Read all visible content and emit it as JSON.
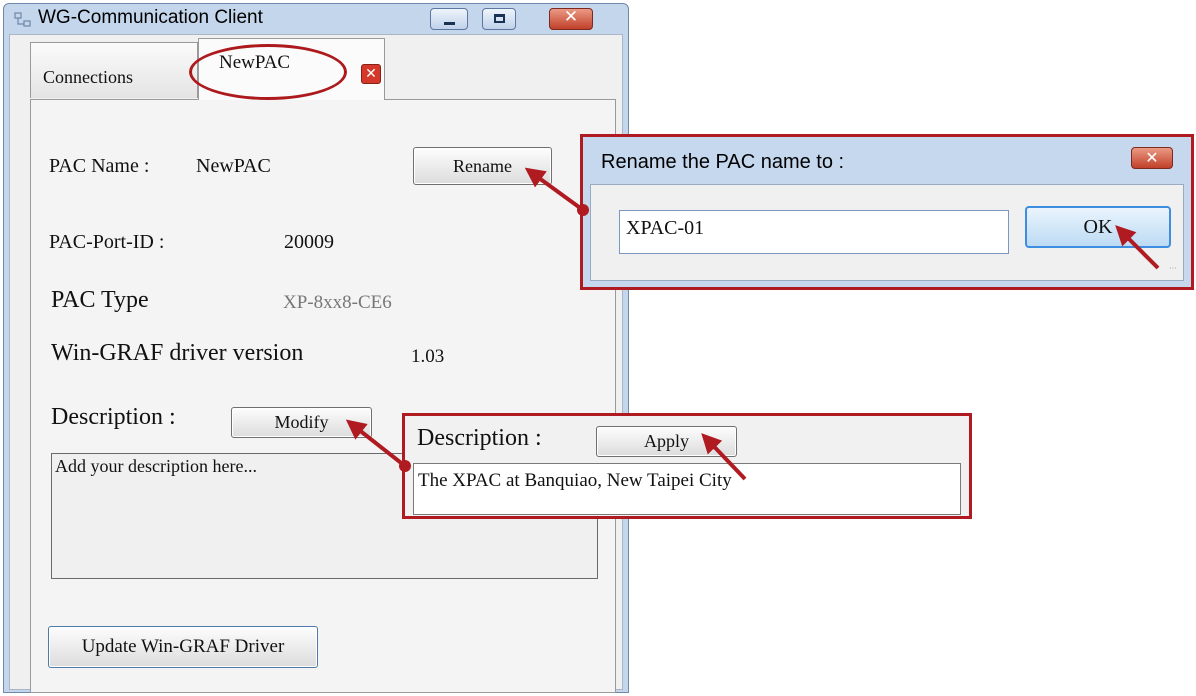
{
  "window": {
    "title": "WG-Communication Client",
    "close_glyph": "✕"
  },
  "tabs": [
    {
      "label": "Connections"
    },
    {
      "label": "NewPAC",
      "close_glyph": "✕"
    }
  ],
  "pac": {
    "name_label": "PAC Name :",
    "name_value": "NewPAC",
    "rename_button": "Rename",
    "port_label": "PAC-Port-ID :",
    "port_value": "20009",
    "type_label": "PAC Type",
    "type_value": "XP-8xx8-CE6",
    "driver_label": "Win-GRAF driver version",
    "driver_value": "1.03",
    "description_label": "Description :",
    "modify_button": "Modify",
    "description_text": "Add your description here...",
    "update_button": "Update Win-GRAF Driver"
  },
  "rename_dialog": {
    "title": "Rename the PAC name to :",
    "close_glyph": "✕",
    "input_value": "XPAC-01",
    "ok_button": "OK"
  },
  "description_dialog": {
    "label": "Description :",
    "apply_button": "Apply",
    "input_value": "The XPAC at Banquiao, New Taipei City"
  },
  "colors": {
    "highlight": "#b01b21",
    "title_bar": "#c4d6ec"
  }
}
